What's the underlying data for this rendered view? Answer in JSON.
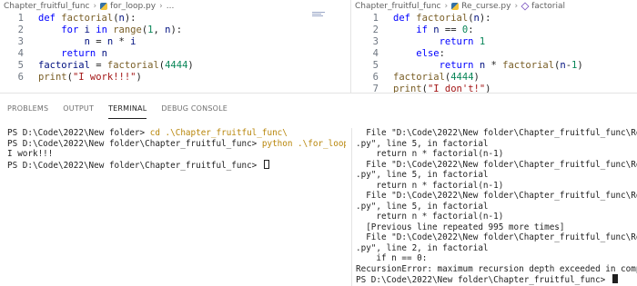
{
  "left_editor": {
    "breadcrumb": {
      "folder": "Chapter_fruitful_func",
      "file": "for_loop.py",
      "trail": "..."
    },
    "lines": [
      {
        "n": "1",
        "parts": [
          {
            "c": "kw",
            "t": "def "
          },
          {
            "c": "fn",
            "t": "factorial"
          },
          {
            "c": "",
            "t": "("
          },
          {
            "c": "var",
            "t": "n"
          },
          {
            "c": "",
            "t": "):"
          }
        ]
      },
      {
        "n": "2",
        "parts": [
          {
            "c": "",
            "t": "    "
          },
          {
            "c": "kw",
            "t": "for "
          },
          {
            "c": "var",
            "t": "i "
          },
          {
            "c": "kw",
            "t": "in "
          },
          {
            "c": "fn",
            "t": "range"
          },
          {
            "c": "",
            "t": "("
          },
          {
            "c": "num",
            "t": "1"
          },
          {
            "c": "",
            "t": ", "
          },
          {
            "c": "var",
            "t": "n"
          },
          {
            "c": "",
            "t": "):"
          }
        ]
      },
      {
        "n": "3",
        "parts": [
          {
            "c": "",
            "t": "        "
          },
          {
            "c": "var",
            "t": "n"
          },
          {
            "c": "",
            "t": " = "
          },
          {
            "c": "var",
            "t": "n"
          },
          {
            "c": "",
            "t": " * "
          },
          {
            "c": "var",
            "t": "i"
          }
        ]
      },
      {
        "n": "4",
        "parts": [
          {
            "c": "",
            "t": "    "
          },
          {
            "c": "kw",
            "t": "return "
          },
          {
            "c": "var",
            "t": "n"
          }
        ]
      },
      {
        "n": "5",
        "parts": [
          {
            "c": "var",
            "t": "factorial"
          },
          {
            "c": "",
            "t": " = "
          },
          {
            "c": "fn",
            "t": "factorial"
          },
          {
            "c": "",
            "t": "("
          },
          {
            "c": "num",
            "t": "4444"
          },
          {
            "c": "",
            "t": ")"
          }
        ]
      },
      {
        "n": "6",
        "parts": [
          {
            "c": "fn",
            "t": "print"
          },
          {
            "c": "",
            "t": "("
          },
          {
            "c": "str",
            "t": "\"I work!!!\""
          },
          {
            "c": "",
            "t": ")"
          }
        ]
      }
    ]
  },
  "right_editor": {
    "breadcrumb": {
      "folder": "Chapter_fruitful_func",
      "file": "Re_curse.py",
      "symbol": "factorial"
    },
    "lines": [
      {
        "n": "1",
        "parts": [
          {
            "c": "kw",
            "t": "def "
          },
          {
            "c": "fn",
            "t": "factorial"
          },
          {
            "c": "",
            "t": "("
          },
          {
            "c": "var",
            "t": "n"
          },
          {
            "c": "",
            "t": "):"
          }
        ]
      },
      {
        "n": "2",
        "parts": [
          {
            "c": "",
            "t": "    "
          },
          {
            "c": "kw",
            "t": "if "
          },
          {
            "c": "var",
            "t": "n"
          },
          {
            "c": "",
            "t": " == "
          },
          {
            "c": "num",
            "t": "0"
          },
          {
            "c": "",
            "t": ":"
          }
        ]
      },
      {
        "n": "3",
        "parts": [
          {
            "c": "",
            "t": "        "
          },
          {
            "c": "kw",
            "t": "return "
          },
          {
            "c": "num",
            "t": "1"
          }
        ]
      },
      {
        "n": "4",
        "parts": [
          {
            "c": "",
            "t": "    "
          },
          {
            "c": "kw",
            "t": "else"
          },
          {
            "c": "",
            "t": ":"
          }
        ]
      },
      {
        "n": "5",
        "parts": [
          {
            "c": "",
            "t": "        "
          },
          {
            "c": "kw",
            "t": "return "
          },
          {
            "c": "var",
            "t": "n"
          },
          {
            "c": "",
            "t": " * "
          },
          {
            "c": "fn",
            "t": "factorial"
          },
          {
            "c": "",
            "t": "("
          },
          {
            "c": "var",
            "t": "n"
          },
          {
            "c": "",
            "t": "-"
          },
          {
            "c": "num",
            "t": "1"
          },
          {
            "c": "",
            "t": ")"
          }
        ]
      },
      {
        "n": "6",
        "parts": [
          {
            "c": "fn",
            "t": "factorial"
          },
          {
            "c": "",
            "t": "("
          },
          {
            "c": "num",
            "t": "4444"
          },
          {
            "c": "",
            "t": ")"
          }
        ]
      },
      {
        "n": "7",
        "parts": [
          {
            "c": "fn",
            "t": "print"
          },
          {
            "c": "",
            "t": "("
          },
          {
            "c": "str",
            "t": "\"I don't!\""
          },
          {
            "c": "",
            "t": ")"
          }
        ]
      }
    ]
  },
  "panel": {
    "tabs": [
      {
        "label": "PROBLEMS",
        "active": false
      },
      {
        "label": "OUTPUT",
        "active": false
      },
      {
        "label": "TERMINAL",
        "active": true
      },
      {
        "label": "DEBUG CONSOLE",
        "active": false
      }
    ]
  },
  "terminal_left": {
    "lines": [
      {
        "prompt": "PS D:\\Code\\2022\\New folder> ",
        "cmd": "cd .\\Chapter_fruitful_func\\",
        "text": ""
      },
      {
        "prompt": "PS D:\\Code\\2022\\New folder\\Chapter_fruitful_func> ",
        "cmd": "python .\\for_loop.py",
        "text": ""
      },
      {
        "prompt": "",
        "cmd": "",
        "text": "I work!!!"
      },
      {
        "prompt": "PS D:\\Code\\2022\\New folder\\Chapter_fruitful_func> ",
        "cmd": "",
        "text": "",
        "cursor": true
      }
    ]
  },
  "terminal_right": {
    "lines": [
      "  File \"D:\\Code\\2022\\New folder\\Chapter_fruitful_func\\Re_curse",
      ".py\", line 5, in factorial",
      "    return n * factorial(n-1)",
      "  File \"D:\\Code\\2022\\New folder\\Chapter_fruitful_func\\Re_curse",
      ".py\", line 5, in factorial",
      "    return n * factorial(n-1)",
      "  File \"D:\\Code\\2022\\New folder\\Chapter_fruitful_func\\Re_curse",
      ".py\", line 5, in factorial",
      "    return n * factorial(n-1)",
      "  [Previous line repeated 995 more times]",
      "  File \"D:\\Code\\2022\\New folder\\Chapter_fruitful_func\\Re_curse",
      ".py\", line 2, in factorial",
      "    if n == 0:",
      "RecursionError: maximum recursion depth exceeded in comparison",
      "PS D:\\Code\\2022\\New folder\\Chapter_fruitful_func> "
    ]
  }
}
